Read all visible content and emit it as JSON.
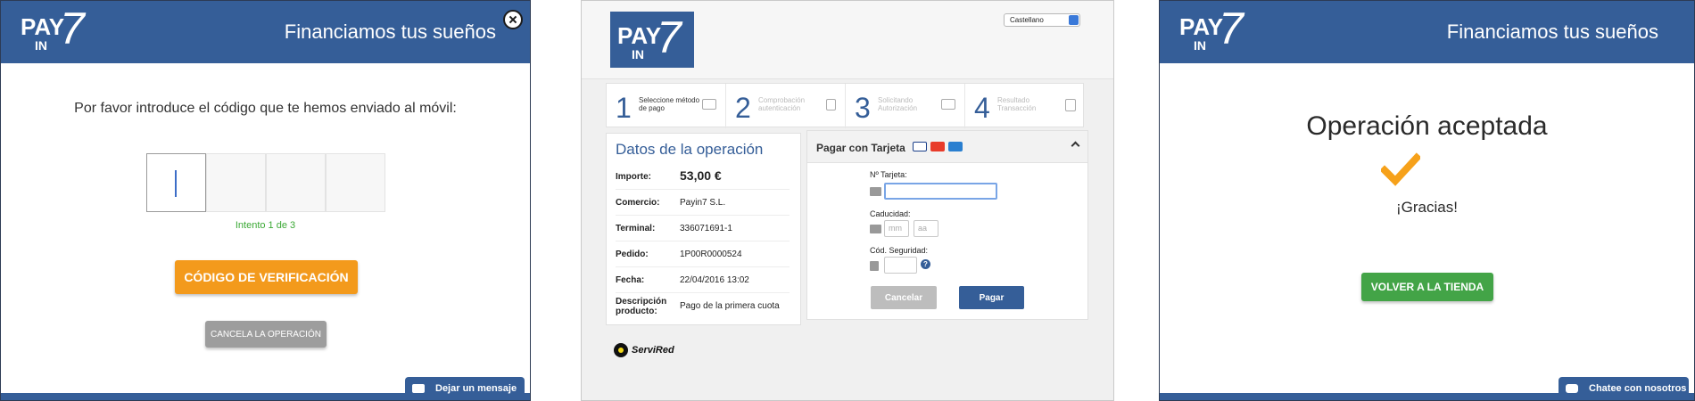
{
  "panel1": {
    "header_title": "Financiamos tus sueños",
    "prompt": "Por favor introduce el código que te hemos enviado al móvil:",
    "attempt": "Intento 1 de 3",
    "verify_button": "CÓDIGO DE VERIFICACIÓN",
    "cancel_button": "CANCELA LA OPERACIÓN",
    "chat_label": "Dejar un mensaje"
  },
  "logo": {
    "pay": "PAY",
    "in": "IN",
    "seven": "7"
  },
  "panel2": {
    "language": "Castellano",
    "steps": [
      {
        "num": "1",
        "label": "Seleccione método de pago"
      },
      {
        "num": "2",
        "label": "Comprobación autenticación"
      },
      {
        "num": "3",
        "label": "Solicitando Autorización"
      },
      {
        "num": "4",
        "label": "Resultado Transacción"
      }
    ],
    "operation": {
      "title": "Datos de la operación",
      "rows": [
        {
          "key": "Importe:",
          "value": "53,00 €"
        },
        {
          "key": "Comercio:",
          "value": "Payin7 S.L."
        },
        {
          "key": "Terminal:",
          "value": "336071691-1"
        },
        {
          "key": "Pedido:",
          "value": "1P00R0000524"
        },
        {
          "key": "Fecha:",
          "value": "22/04/2016  13:02"
        },
        {
          "key": "Descripción producto:",
          "value": "Pago de la primera cuota"
        }
      ]
    },
    "payment": {
      "title": "Pagar con Tarjeta",
      "card_number_label": "Nº Tarjeta:",
      "expiry_label": "Caducidad:",
      "month_placeholder": "mm",
      "year_placeholder": "aa",
      "security_label": "Cód. Seguridad:",
      "help": "?",
      "cancel_button": "Cancelar",
      "pay_button": "Pagar"
    },
    "servired": "ServiRed"
  },
  "panel3": {
    "header_title": "Financiamos tus sueños",
    "title": "Operación aceptada",
    "thanks": "¡Gracias!",
    "back_button": "VOLVER A LA TIENDA",
    "chat_label": "Chatee con nosotros"
  },
  "colors": {
    "brand_blue": "#355e98",
    "orange": "#f39a1c",
    "green": "#43a447",
    "check_orange": "#f6a11a"
  }
}
